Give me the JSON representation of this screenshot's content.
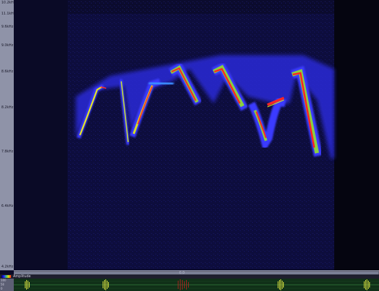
{
  "frequency_axis": {
    "ticks": [
      "10.2kHz",
      "11.1kHz",
      "9.6kHz",
      "9.0kHz",
      "8.6kHz",
      "8.2kHz",
      "7.8kHz",
      "6.4kHz",
      "4.2kHz"
    ]
  },
  "scrollbar": {
    "label": "0.0"
  },
  "legend": {
    "label": "Amplitude"
  },
  "waveform": {
    "scale_labels": [
      "100",
      "50",
      "0"
    ]
  },
  "colors": {
    "background": "#0a0a26",
    "low": "#2020ff",
    "mid": "#40c080",
    "high": "#e0e000",
    "peak": "#ff2020"
  }
}
